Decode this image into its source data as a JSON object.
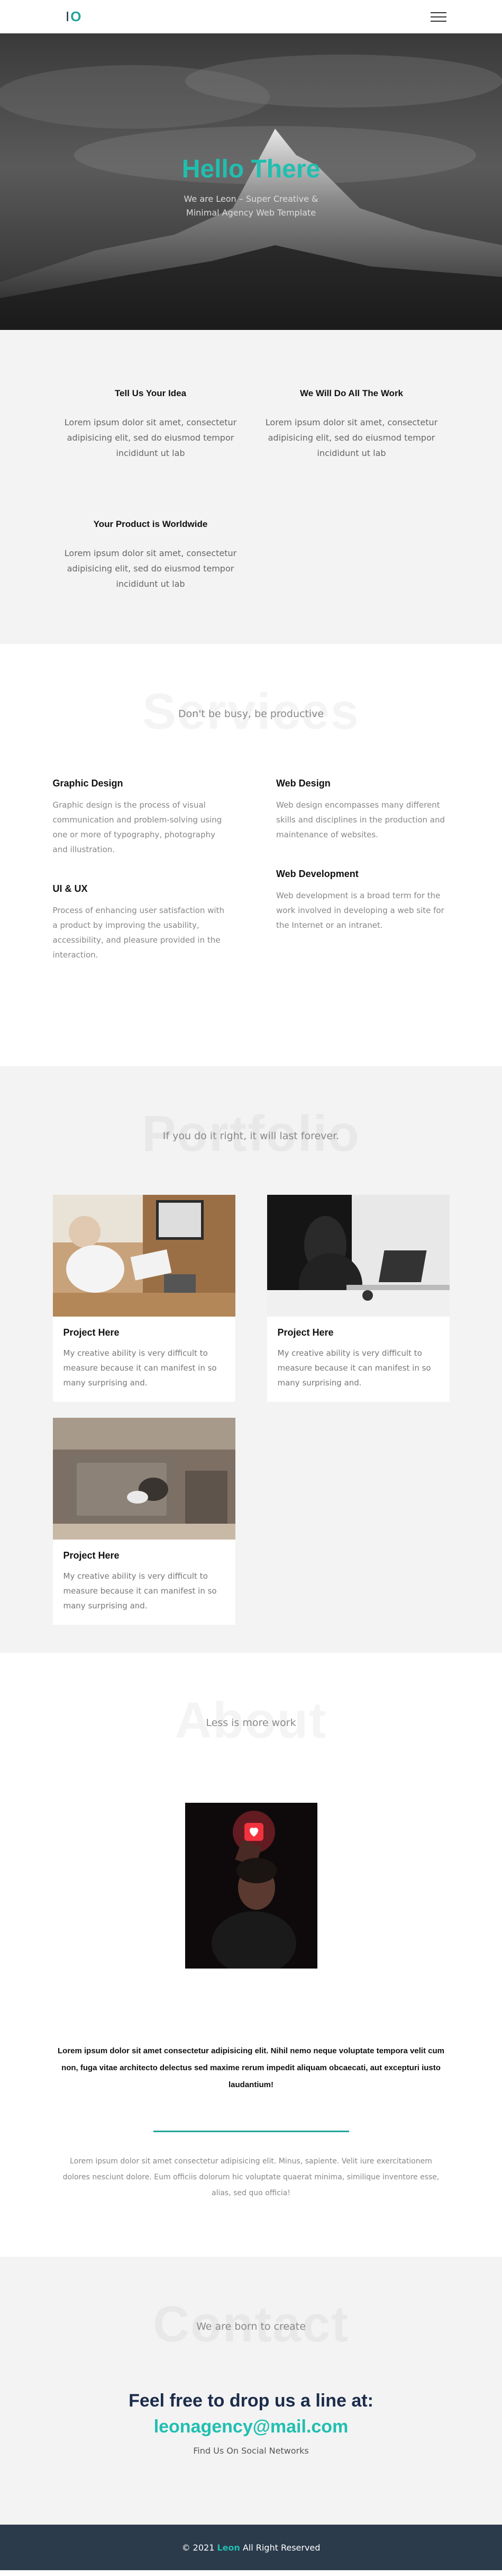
{
  "nav": {
    "logo_i": "I",
    "logo_o": "O"
  },
  "hero": {
    "title": "Hello There",
    "subtitle": "We are Leon – Super Creative & Minimal Agency Web Template"
  },
  "features": [
    {
      "title": "Tell Us Your Idea",
      "text": "Lorem ipsum dolor sit amet, consectetur adipisicing elit, sed do eiusmod tempor incididunt ut lab"
    },
    {
      "title": "We Will Do All The Work",
      "text": "Lorem ipsum dolor sit amet, consectetur adipisicing elit, sed do eiusmod tempor incididunt ut lab"
    },
    {
      "title": "Your Product is Worldwide",
      "text": "Lorem ipsum dolor sit amet, consectetur adipisicing elit, sed do eiusmod tempor incididunt ut lab"
    }
  ],
  "services": {
    "bg_title": "Services",
    "subtitle": "Don't be busy, be productive",
    "items": [
      {
        "title": "Graphic Design",
        "text": "Graphic design is the process of visual communication and problem-solving using one or more of typography, photography and illustration."
      },
      {
        "title": "Web Design",
        "text": "Web design encompasses many different skills and disciplines in the production and maintenance of websites."
      },
      {
        "title": "UI & UX",
        "text": "Process of enhancing user satisfaction with a product by improving the usability, accessibility, and pleasure provided in the interaction."
      },
      {
        "title": "Web Development",
        "text": "Web development is a broad term for the work involved in developing a web site for the Internet or an intranet."
      }
    ]
  },
  "portfolio": {
    "bg_title": "Portfolio",
    "subtitle": "If you do it right, it will last forever.",
    "projects": [
      {
        "title": "Project Here",
        "text": "My creative ability is very difficult to measure because it can manifest in so many surprising and."
      },
      {
        "title": "Project Here",
        "text": "My creative ability is very difficult to measure because it can manifest in so many surprising and."
      },
      {
        "title": "Project Here",
        "text": "My creative ability is very difficult to measure because it can manifest in so many surprising and."
      }
    ]
  },
  "about": {
    "bg_title": "About",
    "subtitle": "Less is more work",
    "bold_text": "Lorem ipsum dolor sit amet consectetur adipisicing elit. Nihil nemo neque voluptate tempora velit cum non, fuga vitae architecto delectus sed maxime rerum impedit aliquam obcaecati, aut excepturi iusto laudantium!",
    "paragraph": "Lorem ipsum dolor sit amet consectetur adipisicing elit. Minus, sapiente. Velit iure exercitationem dolores nesciunt dolore. Eum officiis dolorum hic voluptate quaerat minima, similique inventore esse, alias, sed quo officia!"
  },
  "contact": {
    "bg_title": "Contact",
    "subtitle": "We are born to create",
    "heading": "Feel free to drop us a line at:",
    "email": "leonagency@mail.com",
    "social": "Find Us On Social Networks"
  },
  "footer": {
    "prefix": "© 2021",
    "brand": "Leon",
    "suffix": "All Right Reserved"
  },
  "colors": {
    "accent": "#1fbfb0",
    "dark": "#2b3b4c",
    "light_bg": "#f3f3f3"
  },
  "icons": {
    "menu": "hamburger-menu-icon"
  }
}
